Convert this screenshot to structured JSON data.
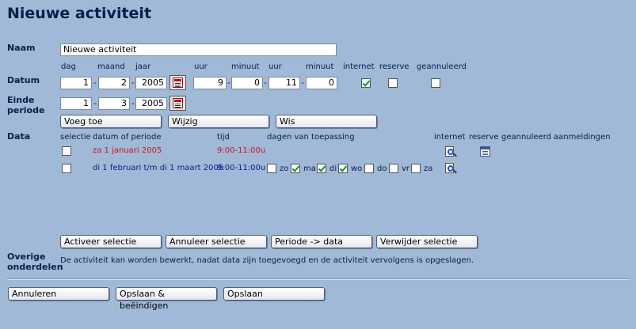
{
  "title": "Nieuwe activiteit",
  "labels": {
    "naam": "Naam",
    "datum": "Datum",
    "einde_line1": "Einde",
    "einde_line2": "periode",
    "data": "Data",
    "overige_line1": "Overige",
    "overige_line2": "onderdelen"
  },
  "naam_value": "Nieuwe activiteit",
  "date_headers": {
    "dag": "dag",
    "maand": "maand",
    "jaar": "jaar",
    "uur1": "uur",
    "minuut1": "minuut",
    "uur2": "uur",
    "minuut2": "minuut",
    "internet": "internet",
    "reserve": "reserve",
    "geannuleerd": "geannuleerd"
  },
  "datum": {
    "dag": "1",
    "maand": "2",
    "jaar": "2005",
    "uur_van": "9",
    "minuut_van": "0",
    "uur_tot": "11",
    "minuut_tot": "0",
    "sep": "-",
    "internet": true,
    "reserve": false,
    "geannuleerd": false
  },
  "einde": {
    "dag": "1",
    "maand": "3",
    "jaar": "2005"
  },
  "buttons": {
    "voeg_toe": "Voeg toe",
    "wijzig": "Wijzig",
    "wis": "Wis",
    "activeer": "Activeer selectie",
    "annuleer_sel": "Annuleer selectie",
    "periode": "Periode -> data",
    "verwijder": "Verwijder selectie",
    "annuleren": "Annuleren",
    "opslaan_beeindigen": "Opslaan & beëindigen",
    "opslaan": "Opslaan"
  },
  "data_headers": {
    "selectie": "selectie",
    "datum_periode": "datum of periode",
    "tijd": "tijd",
    "dagen": "dagen van toepassing",
    "internet": "internet",
    "reserve": "reserve",
    "geannuleerd": "geannuleerd",
    "aanmeldingen": "aanmeldingen"
  },
  "rows": [
    {
      "datum": "za 1 januari 2005",
      "tijd": "9:00-11:00u",
      "color": "#d0141e"
    },
    {
      "datum": "di 1 februari t/m di 1 maart 2005",
      "tijd": "9:00-11:00u",
      "color": "#0b1d8a"
    }
  ],
  "days": [
    {
      "label": "zo",
      "checked": false
    },
    {
      "label": "ma",
      "checked": true
    },
    {
      "label": "di",
      "checked": true
    },
    {
      "label": "wo",
      "checked": true
    },
    {
      "label": "do",
      "checked": false
    },
    {
      "label": "vr",
      "checked": false
    },
    {
      "label": "za",
      "checked": false
    }
  ],
  "overige_text": "De activiteit kan worden bewerkt, nadat data zijn toegevoegd en de activiteit vervolgens is opgeslagen."
}
